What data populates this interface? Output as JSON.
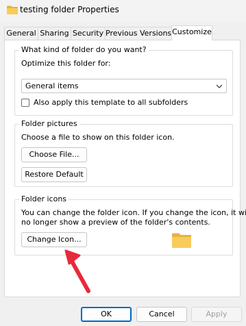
{
  "window": {
    "title": "testing folder Properties",
    "icon": "folder-icon"
  },
  "tabs": [
    {
      "label": "General"
    },
    {
      "label": "Sharing"
    },
    {
      "label": "Security"
    },
    {
      "label": "Previous Versions"
    },
    {
      "label": "Customize",
      "active": true
    }
  ],
  "folder_type": {
    "group_title": "What kind of folder do you want?",
    "optimize_label": "Optimize this folder for:",
    "selected": "General items",
    "apply_subfolders_label": "Also apply this template to all subfolders",
    "apply_subfolders_checked": false
  },
  "folder_pictures": {
    "group_title": "Folder pictures",
    "description": "Choose a file to show on this folder icon.",
    "choose_file_label": "Choose File...",
    "restore_default_label": "Restore Default"
  },
  "folder_icons": {
    "group_title": "Folder icons",
    "description_line1": "You can change the folder icon. If you change the icon, it will",
    "description_line2": "no longer show a preview of the folder's contents.",
    "change_icon_label": "Change Icon...",
    "preview_icon": "folder-icon"
  },
  "footer": {
    "ok_label": "OK",
    "cancel_label": "Cancel",
    "apply_label": "Apply"
  },
  "colors": {
    "accent": "#0067c0",
    "arrow": "#e8293b",
    "folder": "#f5c342"
  }
}
